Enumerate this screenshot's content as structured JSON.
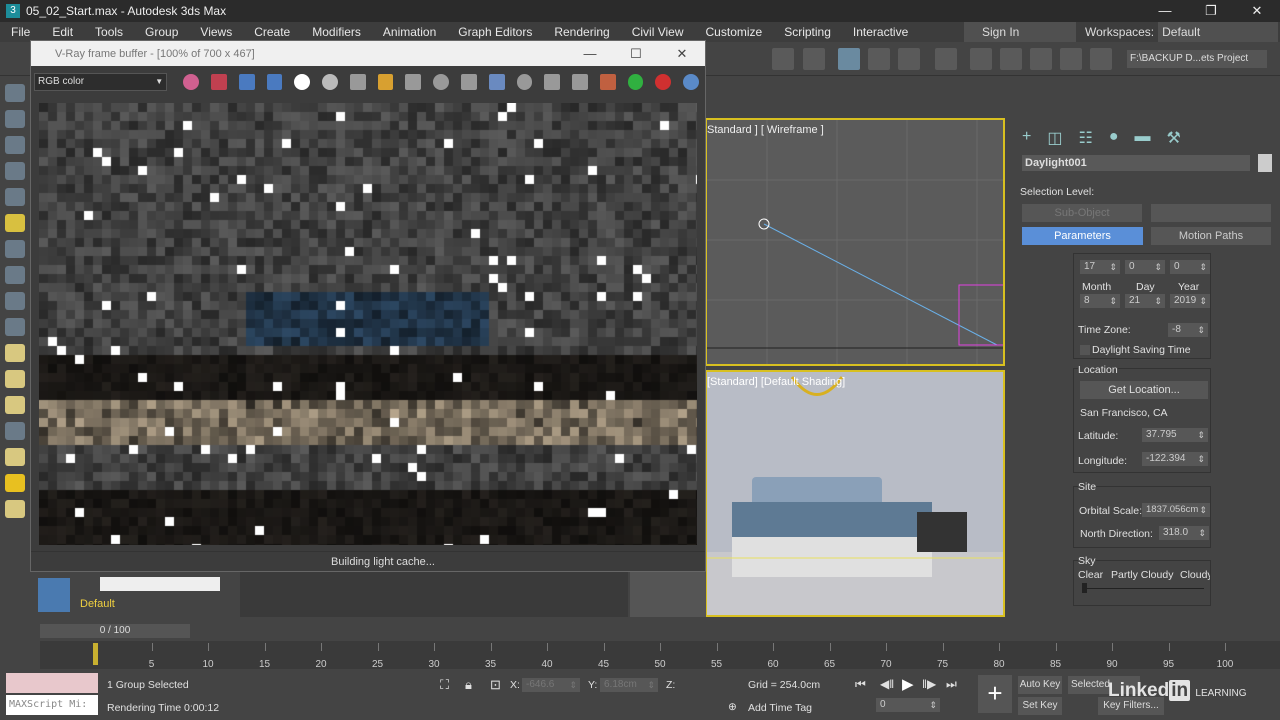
{
  "app": {
    "title": "05_02_Start.max - Autodesk 3ds Max"
  },
  "menu": [
    "File",
    "Edit",
    "Tools",
    "Group",
    "Views",
    "Create",
    "Modifiers",
    "Animation",
    "Graph Editors",
    "Rendering",
    "Civil View",
    "Customize",
    "Scripting",
    "Interactive"
  ],
  "signin": "Sign In",
  "workspaces": {
    "label": "Workspaces:",
    "value": "Default"
  },
  "project_path": "F:\\BACKUP D...ets Project",
  "vfb": {
    "title": "V-Ray frame buffer - [100% of 700 x 467]",
    "channel": "RGB color",
    "status": "Building light cache..."
  },
  "viewports": {
    "top": "Standard ] [ Wireframe ]",
    "persp": "[Standard] [Default Shading]"
  },
  "command_panel": {
    "object_name": "Daylight001",
    "selection_level": "Selection Level:",
    "sub_object": "Sub-Object",
    "parameters": "Parameters",
    "motion_paths": "Motion Paths",
    "time": [
      "17",
      "0",
      "0"
    ],
    "month_label": "Month",
    "day_label": "Day",
    "year_label": "Year",
    "month": "8",
    "day": "21",
    "year": "2019",
    "time_zone_label": "Time Zone:",
    "time_zone": "-8",
    "dst": "Daylight Saving Time",
    "location_label": "Location",
    "get_location": "Get Location...",
    "city": "San Francisco, CA",
    "latitude_label": "Latitude:",
    "latitude": "37.795",
    "longitude_label": "Longitude:",
    "longitude": "-122.394",
    "site_label": "Site",
    "orbital_label": "Orbital Scale:",
    "orbital": "1837.056cm",
    "north_label": "North Direction:",
    "north": "318.0",
    "sky_label": "Sky",
    "sky_clear": "Clear",
    "sky_partly": "Partly Cloudy",
    "sky_cloudy": "Cloudy"
  },
  "layer": {
    "name": "Default"
  },
  "time_slider": "0 / 100",
  "timeline_ticks": [
    0,
    5,
    10,
    15,
    20,
    25,
    30,
    35,
    40,
    45,
    50,
    55,
    60,
    65,
    70,
    75,
    80,
    85,
    90,
    95,
    100
  ],
  "status": {
    "maxscript": "MAXScript Mi:",
    "selection": "1 Group Selected",
    "render_time": "Rendering Time  0:00:12",
    "x_label": "X:",
    "x": "-646.6",
    "y_label": "Y:",
    "y": "6.18cm",
    "z_label": "Z:",
    "grid": "Grid = 254.0cm",
    "add_time_tag": "Add Time Tag",
    "auto_key": "Auto Key",
    "selected": "Selected",
    "set_key": "Set Key",
    "key_filters": "Key Filters...",
    "frame": "0"
  },
  "watermark": "LinkedIn LEARNING"
}
